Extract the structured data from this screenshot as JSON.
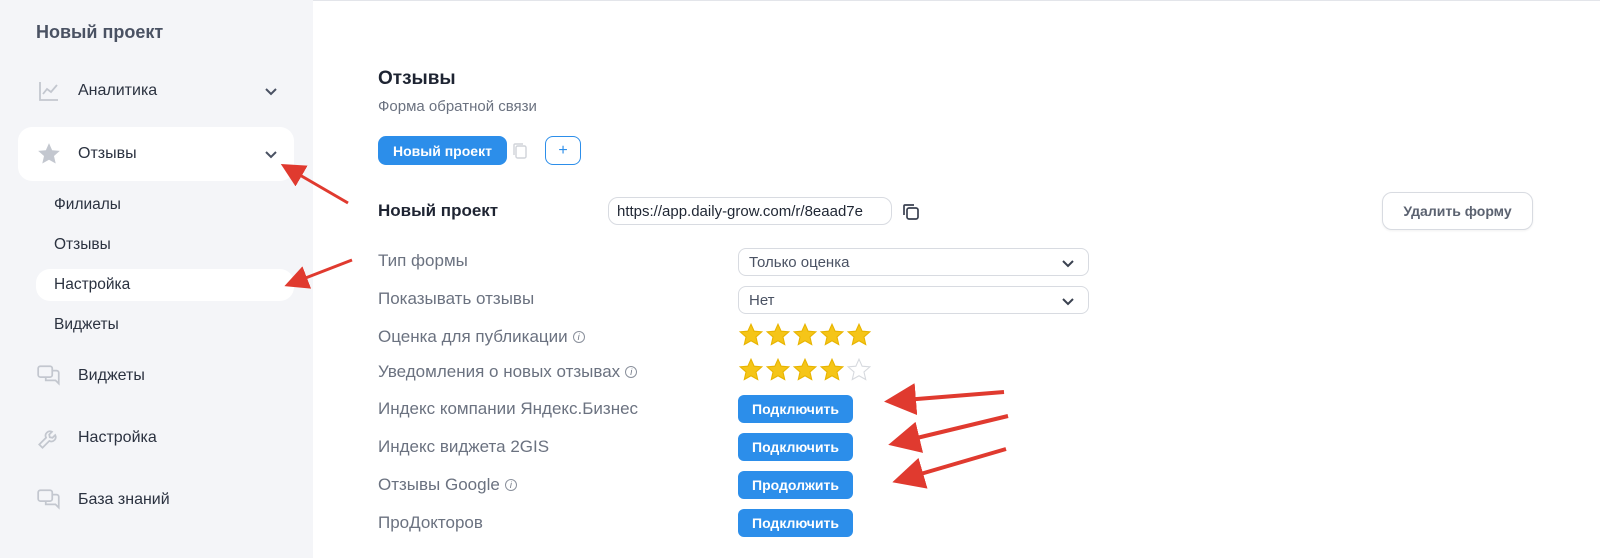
{
  "sidebar": {
    "project_title": "Новый проект",
    "items": [
      {
        "label": "Аналитика",
        "icon": "chart-line-icon"
      },
      {
        "label": "Отзывы",
        "icon": "star-icon"
      },
      {
        "label": "Виджеты",
        "icon": "chat-icon"
      },
      {
        "label": "Настройка",
        "icon": "wrench-icon"
      },
      {
        "label": "База знаний",
        "icon": "chat-icon"
      }
    ],
    "subitems": [
      "Филиалы",
      "Отзывы",
      "Настройка",
      "Виджеты"
    ]
  },
  "main": {
    "title": "Отзывы",
    "subtitle": "Форма обратной связи",
    "project_tab": "Новый проект",
    "add_button": "+",
    "project_name": "Новый проект",
    "form_url": "https://app.daily-grow.com/r/8eaad7e",
    "delete_button": "Удалить форму",
    "rows": {
      "form_type": {
        "label": "Тип формы",
        "value": "Только оценка"
      },
      "show_reviews": {
        "label": "Показывать отзывы",
        "value": "Нет"
      },
      "publish_rating": {
        "label": "Оценка для публикации",
        "stars": 5
      },
      "notify_new": {
        "label": "Уведомления о новых отзывах",
        "stars": 4
      },
      "yandex": {
        "label": "Индекс компании Яндекс.Бизнес",
        "button": "Подключить"
      },
      "twogis": {
        "label": "Индекс виджета 2GIS",
        "button": "Подключить"
      },
      "google": {
        "label": "Отзывы Google",
        "button": "Продолжить"
      },
      "prodoctorov": {
        "label": "ПроДокторов",
        "button": "Подключить"
      }
    }
  },
  "colors": {
    "accent": "#2c8eea",
    "star": "#f5c518",
    "arrow": "#e03a2f",
    "sidebar_bg": "#f4f5f8"
  }
}
